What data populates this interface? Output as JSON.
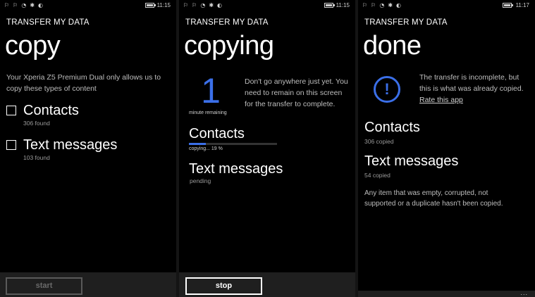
{
  "screens": [
    {
      "status": {
        "time": "11:15"
      },
      "app_title": "TRANSFER MY DATA",
      "page_title": "copy",
      "description": "Your Xperia Z5 Premium Dual only allows us to copy these types of content",
      "items": [
        {
          "label": "Contacts",
          "sub": "306 found"
        },
        {
          "label": "Text messages",
          "sub": "103 found"
        }
      ],
      "button": "start"
    },
    {
      "status": {
        "time": "11:15"
      },
      "app_title": "TRANSFER MY DATA",
      "page_title": "copying",
      "big_number": "1",
      "remaining_label": "minute remaining",
      "description": "Don't go anywhere just yet. You need to remain on this screen for the transfer to complete.",
      "items": [
        {
          "label": "Contacts",
          "sub": "copying... 19 %",
          "progress": 0.19
        },
        {
          "label": "Text messages",
          "sub": "pending"
        }
      ],
      "button": "stop"
    },
    {
      "status": {
        "time": "11:17"
      },
      "app_title": "TRANSFER MY DATA",
      "page_title": "done",
      "alert_icon": "!",
      "description": "The transfer is incomplete, but this is what was already copied.",
      "link": "Rate this app",
      "items": [
        {
          "label": "Contacts",
          "sub": "306 copied"
        },
        {
          "label": "Text messages",
          "sub": "54 copied"
        }
      ],
      "note": "Any item that was empty, corrupted, not supported or a duplicate hasn't been copied.",
      "more_menu": "..."
    }
  ],
  "icons": {
    "status_glyphs": [
      "⚐",
      "⚐",
      "◔",
      "✱",
      "◐"
    ],
    "status_icon_names": [
      "notification-icon",
      "notification-icon",
      "signal-icon",
      "bluetooth-icon",
      "sync-icon"
    ]
  },
  "colors": {
    "accent": "#3b6fe8",
    "background": "#000000",
    "appbar": "#1f1f1f"
  }
}
